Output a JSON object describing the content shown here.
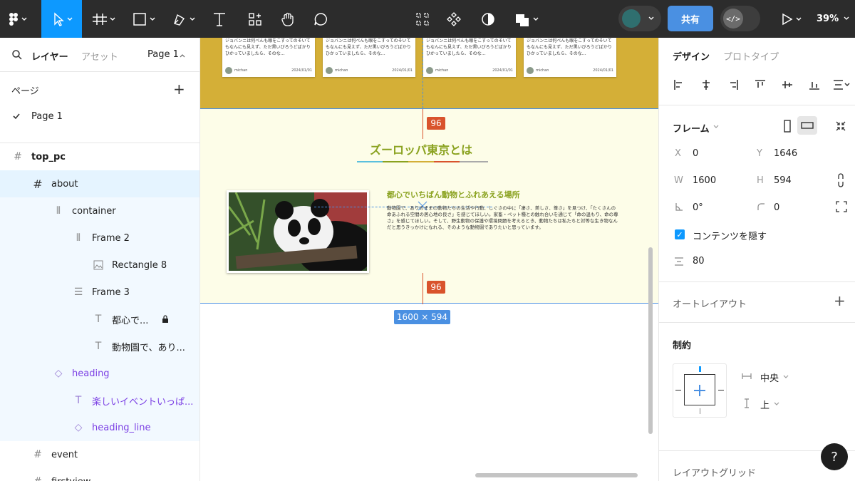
{
  "toolbar": {
    "share_label": "共有",
    "zoom": "39%",
    "devmode_glyph": "</>",
    "colors": {
      "bg": "#2c2c2c",
      "active": "#0d99ff",
      "share": "#4a90e2"
    }
  },
  "left_panel": {
    "tabs": {
      "layers": "レイヤー",
      "assets": "アセット",
      "page": "Page 1"
    },
    "pages_heading": "ページ",
    "pages": [
      "Page 1"
    ],
    "layers": [
      {
        "label": "top_pc"
      },
      {
        "label": "about"
      },
      {
        "label": "container"
      },
      {
        "label": "Frame 2"
      },
      {
        "label": "Rectangle 8"
      },
      {
        "label": "Frame 3"
      },
      {
        "label": "都心で..."
      },
      {
        "label": "動物園で、あり..."
      },
      {
        "label": "heading"
      },
      {
        "label": "楽しいイベントいっぱ..."
      },
      {
        "label": "heading_line"
      },
      {
        "label": "event"
      },
      {
        "label": "firstview"
      }
    ]
  },
  "canvas": {
    "cards": [
      {
        "text": "ジョバンニは何べんも眼をこすってのそいてもなんにも見えず、ただ黒いびろうどばかりひかっていましたら、そのな…",
        "author": "michan",
        "date": "2024/01/01"
      },
      {
        "text": "ジョバンニは何べんも眼をこすってのそいてもなんにも見えず、ただ黒いびろうどばかりひかっていましたら、そのな…",
        "author": "michan",
        "date": "2024/01/01"
      },
      {
        "text": "ジョバンニは何べんも眼をこすってのそいてもなんにも見えず、ただ黒いびろうどばかりひかっていましたら、そのな…",
        "author": "michan",
        "date": "2024/01/01"
      },
      {
        "text": "ジョバンニは何べんも眼をこすってのそいてもなんにも見えず、ただ黒いびろうどばかりひかっていましたら、そのな…",
        "author": "michan",
        "date": "2024/01/01"
      }
    ],
    "spacing_value": "96",
    "heading": "ズーロッパ東京とは",
    "subheading": "都心でいちばん動物とふれあえる場所",
    "body": "動物園で、ありのままの動物たちの生活や行動、しぐさの中に「凄さ、美しさ、尊さ」を見つけ、「たくさんの命あふれる空間の居心地の良さ」を感じてほしい。家畜・ペット種との触れ合いを通じて「命の温もり、命の尊さ」を感じてほしい。そして、野生動物の保護や環境問題を考えるとき、動物たちは私たちと対等な生き物なんだと思うきっかけになれる、そのような動物園でありたいと思っています。",
    "dimensions": "1600 × 594",
    "colors": {
      "top_band": "#d4af37",
      "about_bg": "#fdfde8",
      "heading": "#8aa21f",
      "spacing": "#d9532c",
      "selection": "#4a90e2"
    },
    "heading_line_colors": [
      "#5bc0de",
      "#8aa21f",
      "#d4af37",
      "#d9532c",
      "#aaaaaa"
    ]
  },
  "right_panel": {
    "tabs": {
      "design": "デザイン",
      "prototype": "プロトタイプ"
    },
    "frame_label": "フレーム",
    "x_label": "X",
    "x": "0",
    "y_label": "Y",
    "y": "1646",
    "w_label": "W",
    "w": "1600",
    "h_label": "H",
    "h": "594",
    "rotation": "0°",
    "radius": "0",
    "clip_label": "コンテンツを隠す",
    "spacing": "80",
    "auto_layout_label": "オートレイアウト",
    "constraints_label": "制約",
    "constraint_h": "中央",
    "constraint_v": "上",
    "layout_grid_label": "レイアウトグリッド"
  },
  "help_label": "?"
}
